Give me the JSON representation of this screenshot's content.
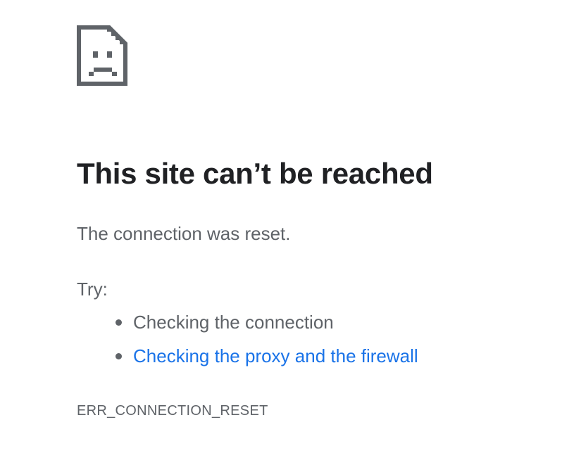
{
  "error_page": {
    "icon": "sad-document-icon",
    "title": "This site can’t be reached",
    "message": "The connection was reset.",
    "try_label": "Try:",
    "suggestions": [
      {
        "text": "Checking the connection",
        "is_link": false
      },
      {
        "text": "Checking the proxy and the firewall",
        "is_link": true
      }
    ],
    "error_code": "ERR_CONNECTION_RESET"
  },
  "colors": {
    "title": "#202124",
    "body_text": "#5f6368",
    "link": "#1a73e8",
    "icon": "#5f6368"
  }
}
